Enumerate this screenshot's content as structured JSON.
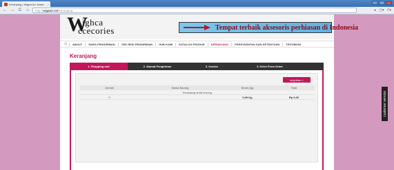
{
  "browser": {
    "tab_title": "Keranjang | Wigha Art Jewel...",
    "tab_close": "×",
    "url_protocol": "http://",
    "url_host": "wigaart.net",
    "url_path": "/keranjang",
    "win_min": "–",
    "win_max": "□",
    "win_close": "×"
  },
  "logo": {
    "initial": "W",
    "line1": "ighca",
    "line2": "ccecories"
  },
  "banner": {
    "text": "Tempat terbaik aksesoris perhiasan di Indonesia"
  },
  "menu": {
    "items": [
      "ABOUT",
      "SIAPA PENGIRIMAN",
      "CEK RESI PENGIRIMAN",
      "HUB KAMI",
      "KATALOG PRODUK",
      "KERANJANG",
      "PERSYARATAN DAN KETENTUAN",
      "TESTIMONI"
    ]
  },
  "heading": "Keranjang",
  "steps": [
    "1. Shopping cart",
    "2. Alamat Pengiriman",
    "3. Invoice",
    "4. Kirim Form Order"
  ],
  "lanjutkan": "lanjutkan »",
  "table": {
    "headers": [
      "Jumlah",
      "Nama Barang",
      "Berat (kg)",
      "Total"
    ],
    "empty_message": "Keranjang anda kosong",
    "total_row": [
      "0",
      "",
      "0,00 Kg",
      "Rp 0,00"
    ]
  },
  "sidebar_tab": "customer service",
  "colors": {
    "accent": "#c2185b",
    "page_bg": "#d499be",
    "banner": "#7fc7ea"
  }
}
